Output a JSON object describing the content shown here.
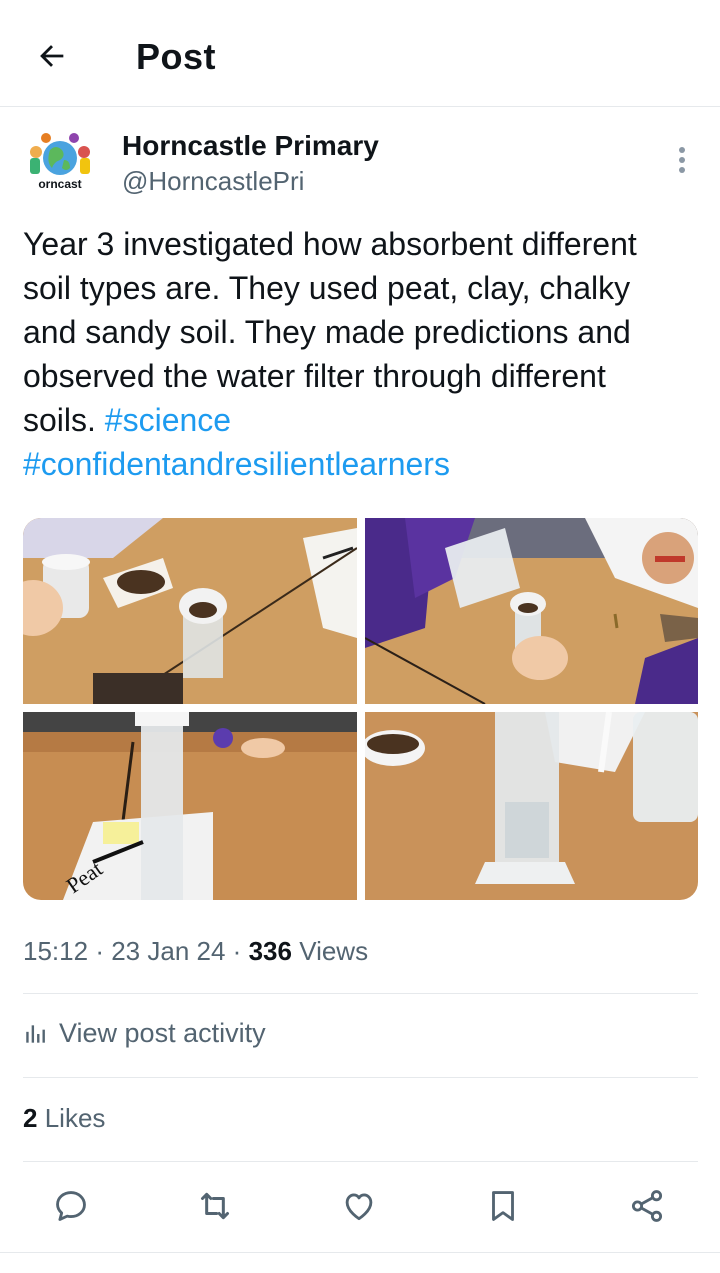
{
  "header": {
    "title": "Post"
  },
  "author": {
    "name": "Horncastle Primary",
    "handle": "@HorncastlePri",
    "avatar_text": "orncast"
  },
  "post": {
    "text_plain": "Year 3 investigated how absorbent different soil types are. They used peat, clay, chalky and sandy soil. They made predictions and observed the water filter through different soils. ",
    "hashtags": [
      "#science",
      "#confidentandresilientlearners"
    ],
    "photos": [
      "soil-filter-photo-1",
      "soil-filter-photo-2",
      "soil-filter-photo-3",
      "soil-filter-photo-4"
    ],
    "photo_caption_text": "Peat"
  },
  "meta": {
    "time": "15:12",
    "date": "23 Jan 24",
    "views_count": "336",
    "views_label": "Views",
    "sep": "·"
  },
  "activity": {
    "label": "View post activity"
  },
  "likes": {
    "count": "2",
    "label": "Likes"
  },
  "actions": [
    "reply-icon",
    "repost-icon",
    "like-icon",
    "bookmark-icon",
    "share-icon"
  ],
  "colors": {
    "link": "#1d9bf0",
    "secondary": "#536471",
    "text": "#0f1419",
    "divider": "#e6e9ec"
  }
}
